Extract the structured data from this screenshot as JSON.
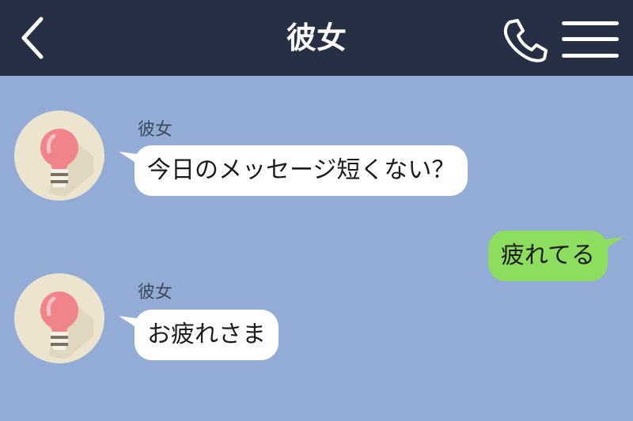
{
  "header": {
    "title": "彼女",
    "back_icon": "chevron-left-icon",
    "call_icon": "phone-icon",
    "menu_icon": "hamburger-menu-icon"
  },
  "colors": {
    "header_bg": "#262f44",
    "chat_bg": "#93acd6",
    "outgoing_bubble": "#8dde5f",
    "incoming_bubble": "#ffffff"
  },
  "messages": [
    {
      "sender": "彼女",
      "direction": "incoming",
      "text": "今日のメッセージ短くない？",
      "avatar_icon": "lightbulb-icon"
    },
    {
      "direction": "outgoing",
      "text": "疲れてる"
    },
    {
      "sender": "彼女",
      "direction": "incoming",
      "text": "お疲れさま",
      "avatar_icon": "lightbulb-icon"
    }
  ]
}
